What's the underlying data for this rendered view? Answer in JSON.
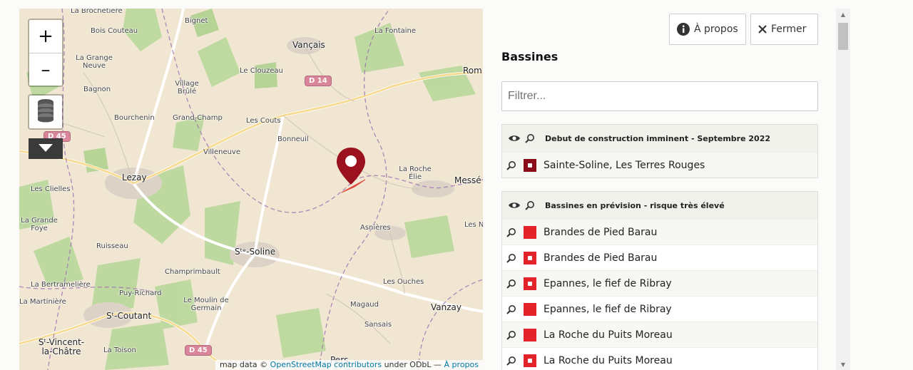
{
  "map": {
    "zoom_in_label": "+",
    "zoom_out_label": "–",
    "layers_icon": "layers-icon",
    "more_icon": "caret-down-icon",
    "places": {
      "la_brochetiere": "La Brochetière",
      "bois_couteau": "Bois Couteau",
      "bignet": "Bignet",
      "vancais": "Vançais",
      "la_fontaine": "La Fontaine",
      "rom": "Rom",
      "la_grange_neuve": "La Grange Neuve",
      "le_clouzeau": "Le Clouzeau",
      "bagnon": "Bagnon",
      "village_brule": "Village Brûlé",
      "bourchenin": "Bourchenin",
      "grand_champ": "Grand-Champ",
      "les_couts": "Les Couts",
      "bonneuil": "Bonneuil",
      "villeneuve": "Villeneuve",
      "lezay": "Lezay",
      "les_clielles": "Les Clielles",
      "la_roche_elie": "La Roche Élie",
      "messe": "Messé",
      "la_grande_foye": "La Grande Foye",
      "ruisseau": "Ruisseau",
      "asnieres": "Asnières",
      "les_n": "Les N",
      "ste_soline": "Sᵗᵉ-Soline",
      "champrimbault": "Champrimbault",
      "la_bertrameliere": "La Bertramelière",
      "puy_richard": "Puy-Richard",
      "les_ouches": "Les Ouches",
      "la_martiniere": "La Martinière",
      "le_moulin_de_germain": "Le Moulin de Germain",
      "st_coutant": "Sᵗ-Coutant",
      "magaud": "Magaud",
      "vanzay": "Vanzay",
      "sansais": "Sansais",
      "st_vincent": "Sᵗ-Vincent-la-Châtre",
      "la_toison": "La Toison",
      "pers": "Pers"
    },
    "roads": {
      "d14": "D 14",
      "d45_top": "D 45",
      "d45_bottom": "D 45"
    },
    "attribution": {
      "prefix": "map data © ",
      "osm": "OpenStreetMap contributors",
      "middle": " under ODbL",
      "sep": " — ",
      "about": "À propos"
    },
    "marker_color": "#9b111e",
    "zone_color": "#e0453a"
  },
  "panel": {
    "about_label": "À propos",
    "about_icon": "info-circle-icon",
    "close_label": "Fermer",
    "close_icon": "close-icon",
    "title": "Bassines",
    "filter_placeholder": "Filtrer...",
    "groups": [
      {
        "title": "Debut de construction imminent - Septembre 2022",
        "items": [
          {
            "label": "Sainte-Soline, Les Terres Rouges",
            "color": "#8b0d1a",
            "type": "point"
          }
        ]
      },
      {
        "title": "Bassines en prévision - risque très élevé",
        "items": [
          {
            "label": "Brandes de Pied Barau",
            "color": "#e2232a",
            "type": "polygon"
          },
          {
            "label": "Brandes de Pied Barau",
            "color": "#e2232a",
            "type": "point"
          },
          {
            "label": "Epannes, le fief de Ribray",
            "color": "#e2232a",
            "type": "point"
          },
          {
            "label": "Epannes, le fief de Ribray",
            "color": "#e2232a",
            "type": "polygon"
          },
          {
            "label": "La Roche du Puits Moreau",
            "color": "#e2232a",
            "type": "polygon"
          },
          {
            "label": "La Roche du Puits Moreau",
            "color": "#e2232a",
            "type": "point"
          }
        ]
      }
    ]
  }
}
